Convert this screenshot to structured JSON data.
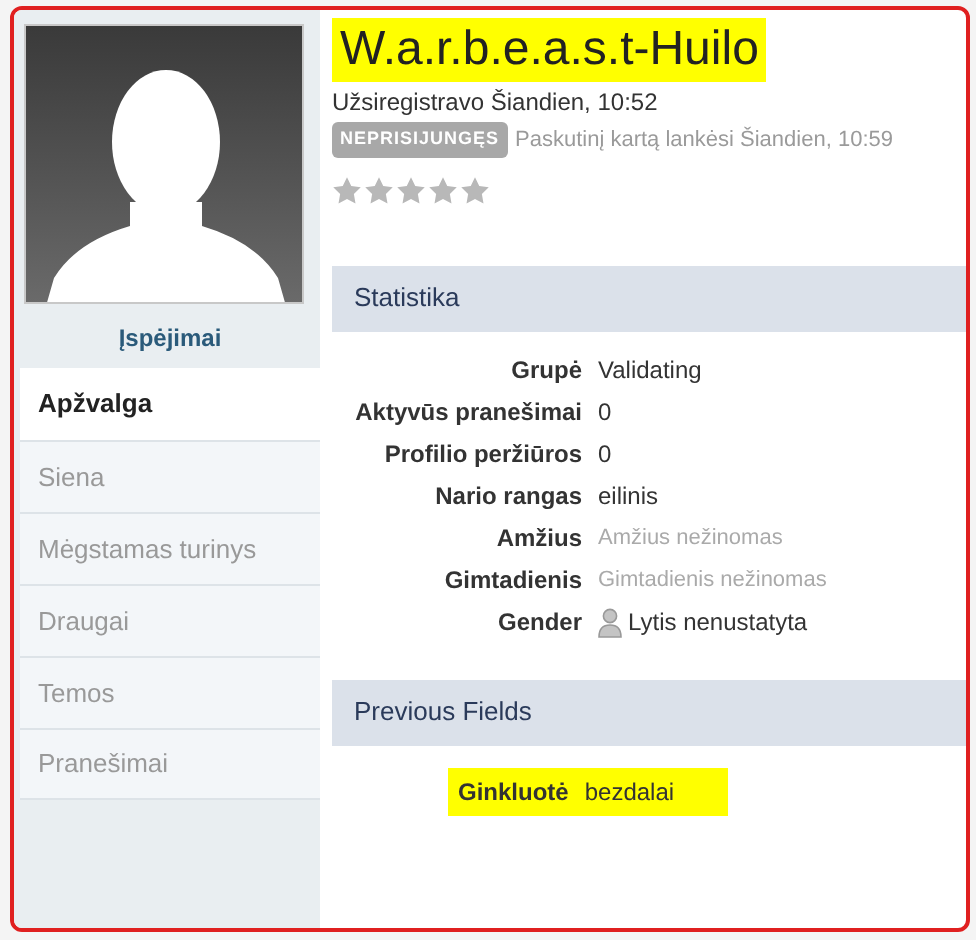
{
  "sidebar": {
    "warnings_link": "Įspėjimai",
    "items": [
      {
        "label": "Apžvalga",
        "selected": true
      },
      {
        "label": "Siena",
        "selected": false
      },
      {
        "label": "Mėgstamas turinys",
        "selected": false
      },
      {
        "label": "Draugai",
        "selected": false
      },
      {
        "label": "Temos",
        "selected": false
      },
      {
        "label": "Pranešimai",
        "selected": false
      }
    ]
  },
  "profile": {
    "name": "W.a.r.b.e.a.s.t-Huilo",
    "name_highlighted": true,
    "registered": "Užsiregistravo Šiandien, 10:52",
    "status_badge": "NEPRISIJUNGĘS",
    "last_visit": "Paskutinį kartą lankėsi Šiandien, 10:59",
    "stars": 0
  },
  "sections": [
    {
      "title": "Statistika",
      "rows": [
        {
          "kind": "text",
          "label": "Grupė",
          "value": "Validating",
          "muted": false,
          "highlighted": false
        },
        {
          "kind": "text",
          "label": "Aktyvūs pranešimai",
          "value": "0",
          "muted": false,
          "highlighted": false
        },
        {
          "kind": "text",
          "label": "Profilio peržiūros",
          "value": "0",
          "muted": false,
          "highlighted": false
        },
        {
          "kind": "text",
          "label": "Nario rangas",
          "value": "eilinis",
          "muted": false,
          "highlighted": false
        },
        {
          "kind": "text",
          "label": "Amžius",
          "value": "Amžius nežinomas",
          "muted": true,
          "highlighted": false
        },
        {
          "kind": "text",
          "label": "Gimtadienis",
          "value": "Gimtadienis nežinomas",
          "muted": true,
          "highlighted": false
        },
        {
          "kind": "person",
          "label": "Gender",
          "value": "Lytis nenustatyta",
          "muted": false,
          "highlighted": false
        }
      ]
    },
    {
      "title": "Previous Fields",
      "rows": [
        {
          "kind": "text",
          "label": "Ginkluotė",
          "value": "bezdalai",
          "muted": false,
          "highlighted": true
        }
      ]
    }
  ]
}
